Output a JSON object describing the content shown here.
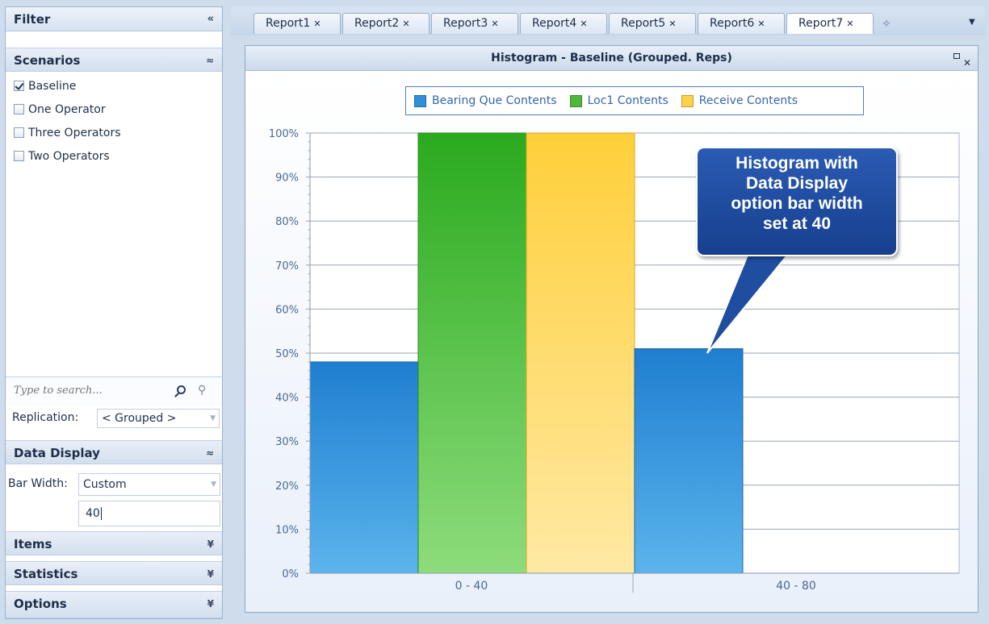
{
  "filter_panel": {
    "title": "Filter",
    "collapse_glyph": "«",
    "scenarios": {
      "header": "Scenarios",
      "glyph": "≈",
      "items": [
        {
          "label": "Baseline",
          "checked": true
        },
        {
          "label": "One Operator",
          "checked": false
        },
        {
          "label": "Three Operators",
          "checked": false
        },
        {
          "label": "Two Operators",
          "checked": false
        }
      ]
    },
    "search": {
      "placeholder": "Type to search..."
    },
    "replication": {
      "label": "Replication:",
      "value": "< Grouped >"
    },
    "data_display": {
      "header": "Data Display",
      "glyph": "≈",
      "bar_width_label": "Bar Width:",
      "bar_width_mode": "Custom",
      "bar_width_value": "40"
    },
    "items_header": "Items",
    "statistics_header": "Statistics",
    "options_header": "Options",
    "expand_glyph": "¥"
  },
  "tabs": [
    "Report1",
    "Report2",
    "Report3",
    "Report4",
    "Report5",
    "Report6",
    "Report7"
  ],
  "chart_window": {
    "title": "Histogram - Baseline (Grouped. Reps)"
  },
  "callout": {
    "lines": [
      "Histogram with",
      "Data Display",
      "option bar width",
      "set at 40"
    ]
  },
  "colors": {
    "bearing": "#2f8fd8",
    "loc1": "#4db83a",
    "receive": "#ffd24a",
    "callout": "#1f4ea0"
  },
  "chart_data": {
    "type": "bar",
    "categories": [
      "0 - 40",
      "40 - 80"
    ],
    "series": [
      {
        "name": "Bearing Que Contents",
        "values": [
          48,
          51
        ]
      },
      {
        "name": "Loc1 Contents",
        "values": [
          100,
          0
        ]
      },
      {
        "name": "Receive Contents",
        "values": [
          100,
          0
        ]
      }
    ],
    "y_ticks": [
      "0%",
      "10%",
      "20%",
      "30%",
      "40%",
      "50%",
      "60%",
      "70%",
      "80%",
      "90%",
      "100%"
    ],
    "ylim": [
      0,
      100
    ],
    "y_unit": "%",
    "grid": true,
    "legend_position": "top"
  }
}
